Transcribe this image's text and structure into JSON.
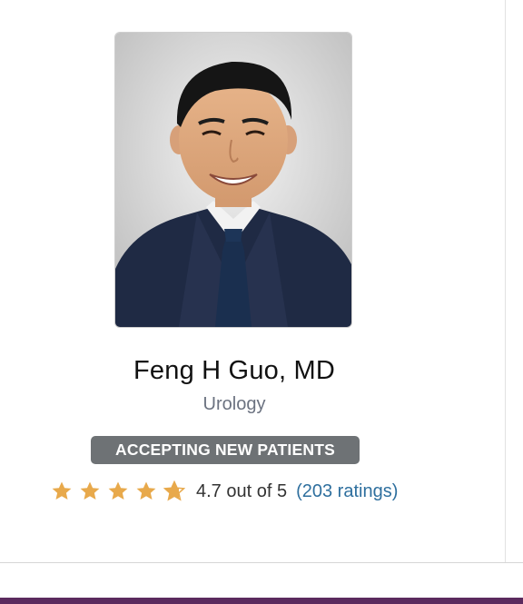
{
  "doctor": {
    "name": "Feng H Guo, MD",
    "specialty": "Urology",
    "badge": "ACCEPTING NEW PATIENTS",
    "photo_icon": "doctor-portrait"
  },
  "rating": {
    "value": 4.7,
    "max": 5,
    "text": "4.7 out of 5",
    "count_link": "(203 ratings)",
    "star_color": "#E8A94B"
  },
  "colors": {
    "badge_bg": "#6E7275",
    "link": "#2E6F9E",
    "bottom_bar": "#5B2A5E"
  }
}
